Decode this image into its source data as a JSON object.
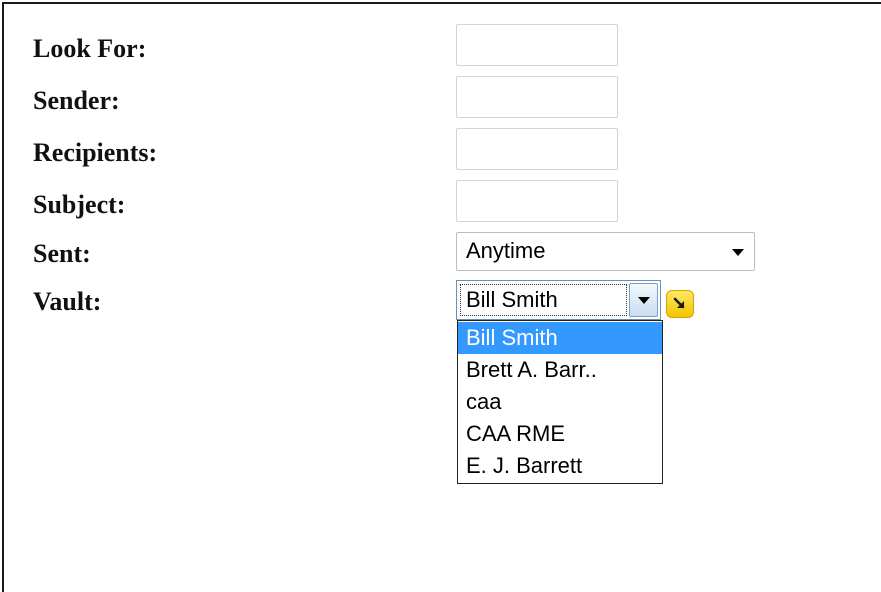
{
  "form": {
    "look_for": {
      "label": "Look For:",
      "value": ""
    },
    "sender": {
      "label": "Sender:",
      "value": ""
    },
    "recipients": {
      "label": "Recipients:",
      "value": ""
    },
    "subject": {
      "label": "Subject:",
      "value": ""
    },
    "sent": {
      "label": "Sent:",
      "selected": "Anytime"
    },
    "vault": {
      "label": "Vault:",
      "selected": "Bill Smith",
      "options": [
        "Bill Smith",
        "Brett A. Barr..",
        "caa",
        "CAA RME",
        "E. J. Barrett"
      ],
      "highlighted_index": 0
    }
  },
  "icons": {
    "dropdown_arrow": "chevron-down-icon",
    "go": "arrow-down-right-icon"
  },
  "colors": {
    "highlight": "#3399ff",
    "go_button": "#f5c400"
  }
}
